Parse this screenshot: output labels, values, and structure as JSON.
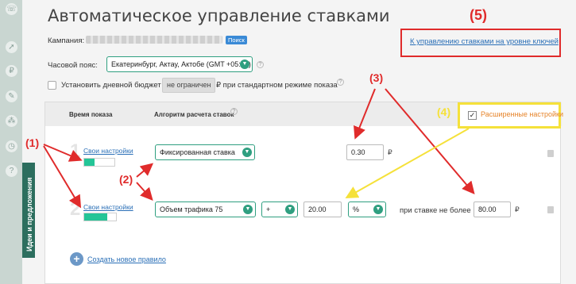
{
  "page_title": "Автоматическое управление ставками",
  "campaign": {
    "label": "Кампания:",
    "search_badge": "Поиск"
  },
  "timezone": {
    "label": "Часовой пояс:",
    "value": "Екатеринбург, Актау, Актобе (GMT +05:00)"
  },
  "budget": {
    "label": "Установить дневной бюджет",
    "button": "не ограничен",
    "suffix": "₽ при стандартном режиме показа"
  },
  "keyword_link": "К управлению ставками на уровне ключей",
  "advanced": {
    "label": "Расширенные настройки",
    "checked_mark": "✓"
  },
  "table": {
    "col_time": "Время показа",
    "col_algo": "Алгоритм расчета ставок",
    "rows": [
      {
        "num": "1",
        "time_link": "Свои настройки",
        "progress": 0.35,
        "algo": "Фиксированная ставка",
        "bid": "0.30",
        "currency": "₽"
      },
      {
        "num": "2",
        "time_link": "Свои настройки",
        "progress": 0.72,
        "algo": "Объем трафика 75",
        "op": "+",
        "value": "20.00",
        "unit": "%",
        "max_label": "при ставке не более",
        "max_value": "80.00",
        "currency": "₽"
      }
    ]
  },
  "create_rule": "Создать новое правило",
  "ideas_tab": "Идеи и предложения",
  "annotations": {
    "a1": "(1)",
    "a2": "(2)",
    "a3": "(3)",
    "a4": "(4)",
    "a5": "(5)"
  },
  "icons": [
    "phone-icon",
    "rocket-icon",
    "ruble-icon",
    "wrench-icon",
    "network-icon",
    "clock-icon",
    "help-icon",
    "chevron-down-icon",
    "trash-icon",
    "plus-icon"
  ],
  "colors": {
    "accent": "#2f9f80",
    "annotation_red": "#e02b2b",
    "highlight_yellow": "#f5e13a",
    "link": "#2a6fb7",
    "progress": "#24c597",
    "advanced_text": "#e6842a"
  }
}
